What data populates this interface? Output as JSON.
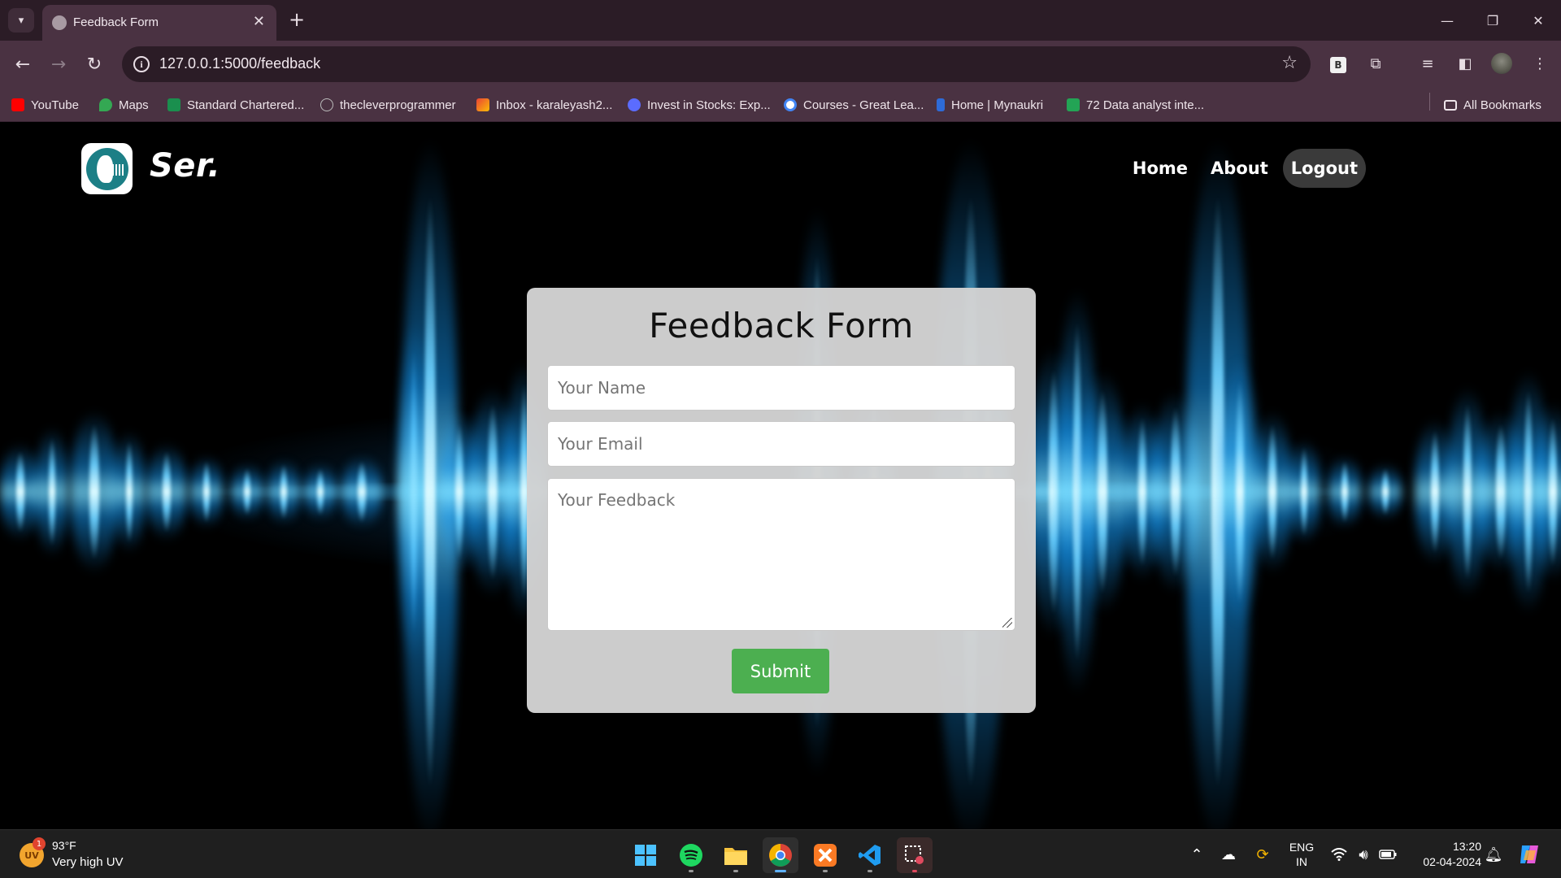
{
  "browser": {
    "tab_title": "Feedback Form",
    "url": "127.0.0.1:5000/feedback",
    "bookmarks": [
      {
        "label": "YouTube",
        "color": "#ff0000"
      },
      {
        "label": "Maps",
        "color": "#34a853"
      },
      {
        "label": "Standard Chartered...",
        "color": "#1a8f4e"
      },
      {
        "label": "thecleverprogrammer",
        "color": "#bbbbbb"
      },
      {
        "label": "Inbox - karaleyash2...",
        "color": "#ea4335"
      },
      {
        "label": "Invest in Stocks: Exp...",
        "color": "#5b6cff"
      },
      {
        "label": "Courses - Great Lea...",
        "color": "#4285f4"
      },
      {
        "label": "Home | Mynaukri",
        "color": "#2e6bd8"
      },
      {
        "label": "72 Data analyst inte...",
        "color": "#23a455"
      }
    ],
    "all_bookmarks": "All Bookmarks"
  },
  "site": {
    "brand": "Ser.",
    "nav": [
      {
        "label": "Home"
      },
      {
        "label": "About"
      },
      {
        "label": "Logout"
      }
    ]
  },
  "form": {
    "title": "Feedback Form",
    "name_placeholder": "Your Name",
    "email_placeholder": "Your Email",
    "feedback_placeholder": "Your Feedback",
    "submit_label": "Submit",
    "submit_color": "#4caf50"
  },
  "taskbar": {
    "weather_badge": "1",
    "weather_icon_text": "UV",
    "weather_temp": "93°F",
    "weather_desc": "Very high UV",
    "lang_top": "ENG",
    "lang_bottom": "IN",
    "time": "13:20",
    "date": "02-04-2024"
  }
}
